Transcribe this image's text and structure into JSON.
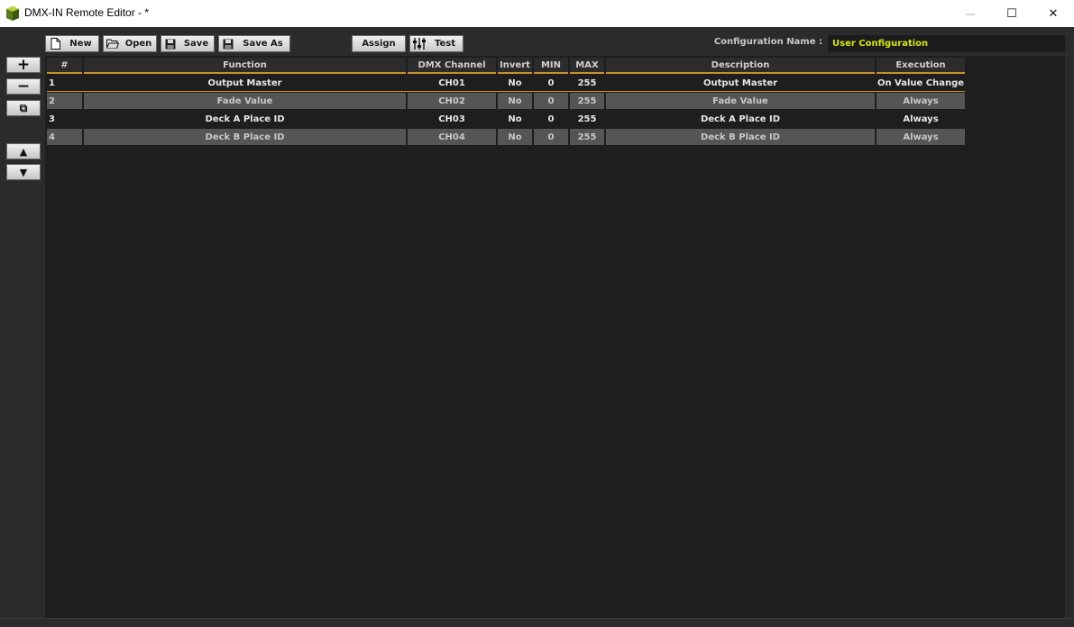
{
  "window": {
    "title": "DMX-IN Remote Editor - *",
    "minimize_glyph": "—",
    "maximize_glyph": "☐",
    "close_glyph": "✕"
  },
  "toolbar": {
    "new_label": "New",
    "open_label": "Open",
    "save_label": "Save",
    "save_as_label": "Save As",
    "assign_label": "Assign",
    "test_label": "Test",
    "config_name_label": "Configuration Name :",
    "config_name_value": "User Configuration"
  },
  "side": {
    "add_glyph": "+",
    "remove_glyph": "−",
    "copy_glyph": "⧉",
    "up_glyph": "▲",
    "down_glyph": "▼"
  },
  "table": {
    "headers": [
      "#",
      "Function",
      "DMX Channel",
      "Invert",
      "MIN",
      "MAX",
      "Description",
      "Execution"
    ],
    "rows": [
      [
        "1",
        "Output Master",
        "CH01",
        "No",
        "0",
        "255",
        "Output Master",
        "On Value Change"
      ],
      [
        "2",
        "Fade Value",
        "CH02",
        "No",
        "0",
        "255",
        "Fade Value",
        "Always"
      ],
      [
        "3",
        "Deck A Place ID",
        "CH03",
        "No",
        "0",
        "255",
        "Deck A Place ID",
        "Always"
      ],
      [
        "4",
        "Deck B Place ID",
        "CH04",
        "No",
        "0",
        "255",
        "Deck B Place ID",
        "Always"
      ]
    ]
  },
  "colors": {
    "accent": "#c8902a",
    "config_text": "#d4e615",
    "panel_bg": "#1e1e1e",
    "row_alt": "#555555"
  },
  "icons": {
    "app": "app-cube-icon",
    "new": "new-file-icon",
    "open": "open-folder-icon",
    "save": "floppy-disk-icon",
    "save_as": "floppy-disk-icon",
    "test": "sliders-icon"
  }
}
